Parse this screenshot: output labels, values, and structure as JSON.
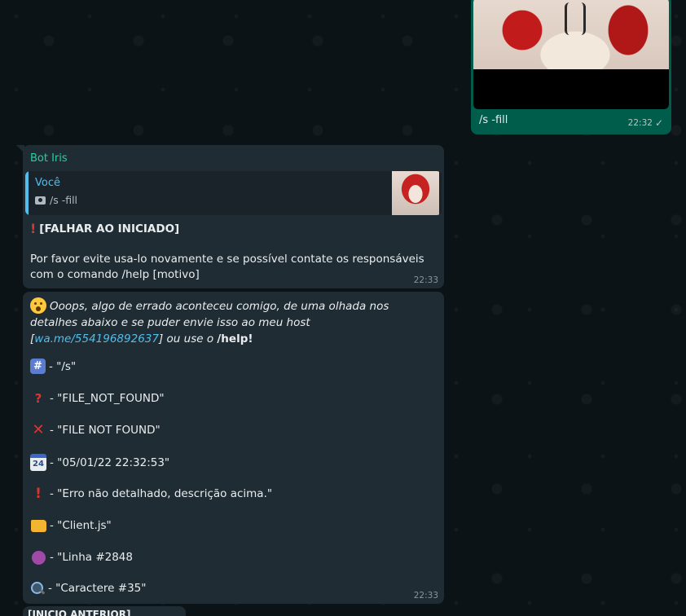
{
  "outgoing": {
    "caption": "/s -fill",
    "time": "22:32",
    "status_icon": "single-check-icon"
  },
  "message1": {
    "sender": "Bot Iris",
    "quote": {
      "author": "Você",
      "text": "/s -fill",
      "icon": "camera-icon"
    },
    "title": "[FALHAR AO INICIADO]",
    "body": "Por favor evite usa-lo novamente e se possível contate os responsáveis com o comando /help [motivo]",
    "time": "22:33"
  },
  "message2": {
    "intro_text": "Ooops, algo de errado aconteceu comigo, de uma olhada nos detalhes abaixo e se puder envie isso ao meu host [",
    "intro_link": "wa.me/554196892637",
    "intro_after": "] ou use o ",
    "intro_cmd": "/help!",
    "lines": [
      {
        "icon": "hash-keycap-icon",
        "text": " - \"/s\""
      },
      {
        "icon": "question-mark-icon",
        "text": "- \"FILE_NOT_FOUND\""
      },
      {
        "icon": "cross-mark-icon",
        "text": "- \"FILE NOT FOUND\""
      },
      {
        "icon": "calendar-icon",
        "text": "- \"05/01/22 22:32:53\""
      },
      {
        "icon": "exclamation-icon",
        "text": "- \"Erro não detalhado, descrição acima.\""
      },
      {
        "icon": "folder-icon",
        "text": "- \"Client.js\""
      },
      {
        "icon": "yarn-icon",
        "text": "- \"Linha #2848"
      },
      {
        "icon": "magnifier-icon",
        "text": "- \"Caractere #35\""
      }
    ],
    "time": "22:33"
  },
  "message3": {
    "partial_text": "[INICIO ANTERIOR]"
  }
}
